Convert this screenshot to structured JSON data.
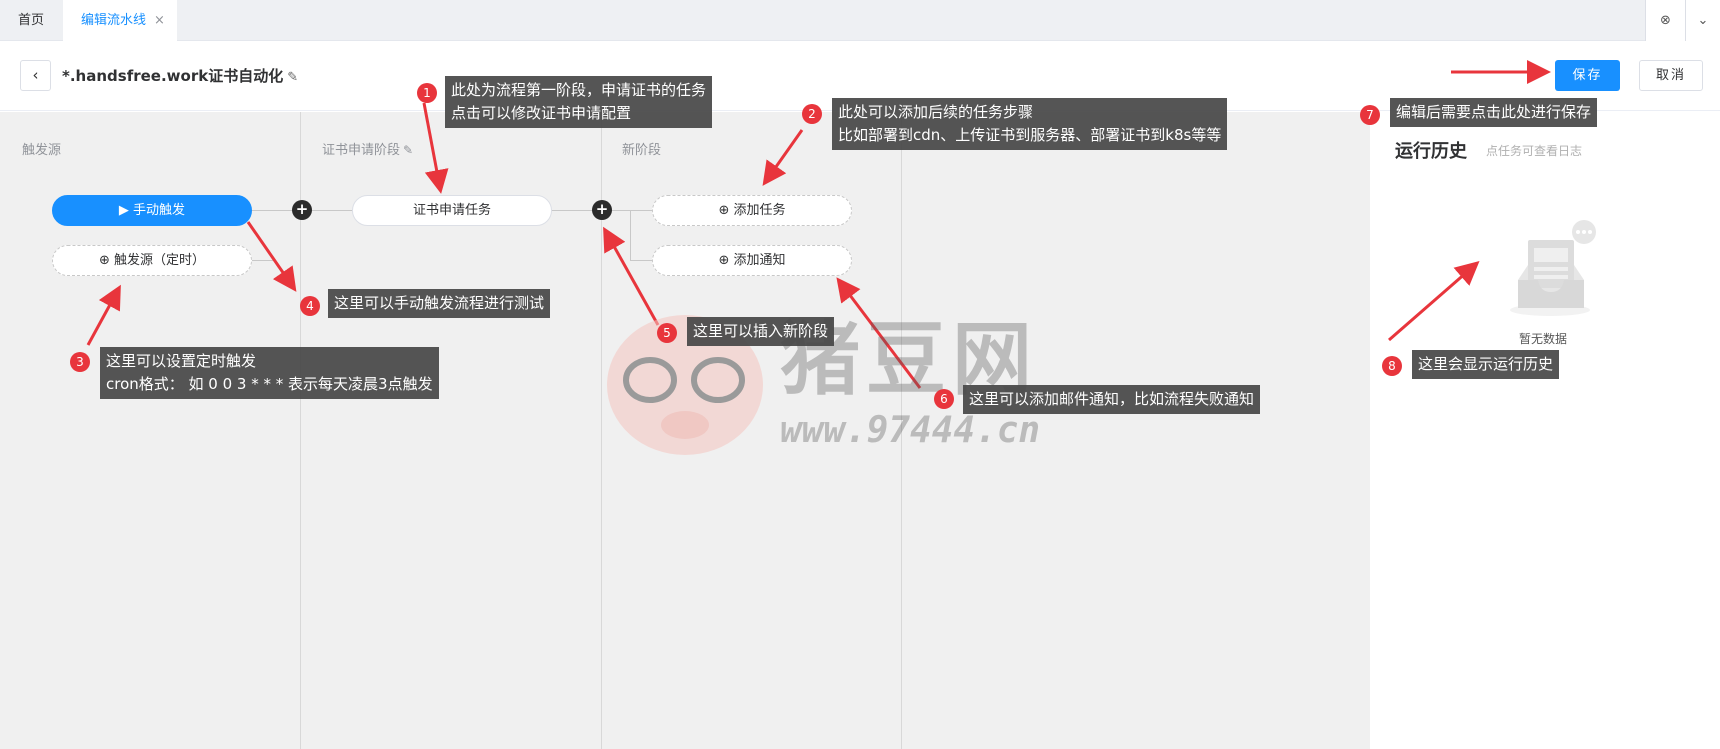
{
  "tabs": {
    "home": "首页",
    "active": "编辑流水线",
    "close": "×",
    "close_all": "⊗",
    "more": "⌄"
  },
  "header": {
    "back": "‹",
    "title": "*.handsfree.work证书自动化",
    "title_edit": "✎",
    "save": "保存",
    "cancel": "取消"
  },
  "stages": {
    "trigger": {
      "title": "触发源"
    },
    "cert": {
      "title": "证书申请阶段",
      "edit": "✎"
    },
    "new": {
      "title": "新阶段"
    }
  },
  "nodes": {
    "manual_trigger": "▶ 手动触发",
    "timer_trigger": "⊕ 触发源（定时）",
    "cert_task": "证书申请任务",
    "add_task": "⊕ 添加任务",
    "add_notify": "⊕ 添加通知",
    "plus": "+"
  },
  "history": {
    "title": "运行历史",
    "hint": "点任务可查看日志",
    "empty": "暂无数据"
  },
  "annotations": [
    {
      "num": "1",
      "lines": [
        "此处为流程第一阶段，申请证书的任务",
        "点击可以修改证书申请配置"
      ]
    },
    {
      "num": "2",
      "lines": [
        "此处可以添加后续的任务步骤",
        "比如部署到cdn、上传证书到服务器、部署证书到k8s等等"
      ]
    },
    {
      "num": "3",
      "lines": [
        "这里可以设置定时触发",
        "cron格式：  如 0 0 3 * * * 表示每天凌晨3点触发"
      ]
    },
    {
      "num": "4",
      "lines": [
        "这里可以手动触发流程进行测试"
      ]
    },
    {
      "num": "5",
      "lines": [
        "这里可以插入新阶段"
      ]
    },
    {
      "num": "6",
      "lines": [
        "这里可以添加邮件通知，比如流程失败通知"
      ]
    },
    {
      "num": "7",
      "lines": [
        "编辑后需要点击此处进行保存"
      ]
    },
    {
      "num": "8",
      "lines": [
        "这里会显示运行历史"
      ]
    }
  ],
  "watermark": {
    "name": "猪豆网",
    "url": "www.97444.cn"
  },
  "colors": {
    "primary": "#1890ff",
    "annotation_red": "#e8353c",
    "annotation_bg": "#464646",
    "canvas_bg": "#f0f0f0"
  }
}
